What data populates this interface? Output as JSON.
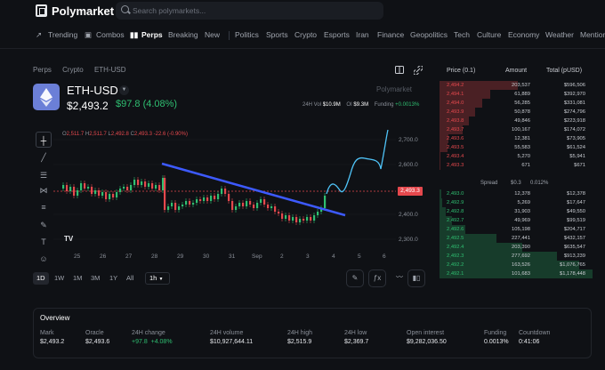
{
  "header": {
    "logo": "Polymarket",
    "search_placeholder": "Search polymarkets...",
    "categories": [
      "Trending",
      "Combos",
      "Perps",
      "Breaking",
      "New",
      "Politics",
      "Sports",
      "Crypto",
      "Esports",
      "Iran",
      "Finance",
      "Geopolitics",
      "Tech",
      "Culture",
      "Economy",
      "Weather",
      "Mention"
    ]
  },
  "market": {
    "breadcrumbs": [
      "Perps",
      "Crypto",
      "ETH-USD"
    ],
    "pair": "ETH-USD",
    "price": "$2,493.2",
    "change": "$97.8 (4.08%)",
    "watermark": "Polymarket",
    "stats": {
      "vol_label": "24H Vol",
      "vol": "$10.9M",
      "oi_label": "OI",
      "oi": "$9.3M",
      "funding_label": "Funding",
      "funding": "+0.0013%"
    }
  },
  "chart": {
    "ohlc": [
      "O",
      "2,511.7",
      "H",
      "2,511.7",
      "L",
      "2,492.8",
      "C",
      "2,493.3",
      "-22.6 (-0.90%)"
    ],
    "current_tag": "2,493.3",
    "price_ticks": [
      "2,700.0",
      "2,600.0",
      "2,500.0",
      "2,400.0",
      "2,300.0"
    ],
    "date_ticks": [
      "25",
      "26",
      "27",
      "28",
      "29",
      "30",
      "31",
      "Sep",
      "2",
      "3",
      "4",
      "5",
      "6"
    ],
    "timeframes": [
      "1D",
      "1W",
      "1M",
      "3M",
      "1Y",
      "All"
    ],
    "interval": "1h"
  },
  "orderbook": {
    "headers": [
      "Price (0.1)",
      "Amount",
      "Total (pUSD)"
    ],
    "asks": [
      [
        "2,494.2",
        "203,537",
        "$596,506"
      ],
      [
        "2,494.1",
        "61,889",
        "$392,970"
      ],
      [
        "2,494.0",
        "56,285",
        "$331,081"
      ],
      [
        "2,493.9",
        "50,878",
        "$274,796"
      ],
      [
        "2,493.8",
        "49,846",
        "$223,918"
      ],
      [
        "2,493.7",
        "100,167",
        "$174,072"
      ],
      [
        "2,493.6",
        "12,381",
        "$73,905"
      ],
      [
        "2,493.5",
        "55,583",
        "$61,524"
      ],
      [
        "2,493.4",
        "5,270",
        "$5,941"
      ],
      [
        "2,493.3",
        "671",
        "$671"
      ]
    ],
    "spread": [
      "Spread",
      "$0.3",
      "0.012%"
    ],
    "bids": [
      [
        "2,493.0",
        "12,378",
        "$12,378"
      ],
      [
        "2,492.9",
        "5,269",
        "$17,647"
      ],
      [
        "2,492.8",
        "31,903",
        "$49,550"
      ],
      [
        "2,492.7",
        "49,969",
        "$99,519"
      ],
      [
        "2,492.6",
        "105,198",
        "$204,717"
      ],
      [
        "2,492.5",
        "227,441",
        "$432,157"
      ],
      [
        "2,492.4",
        "203,390",
        "$635,547"
      ],
      [
        "2,492.3",
        "277,692",
        "$913,239"
      ],
      [
        "2,492.2",
        "163,526",
        "$1,076,765"
      ],
      [
        "2,492.1",
        "101,683",
        "$1,178,448"
      ]
    ],
    "ask_depth": [
      0.51,
      0.33,
      0.28,
      0.23,
      0.19,
      0.15,
      0.06,
      0.05,
      0.005,
      0.0006
    ],
    "bid_depth": [
      0.01,
      0.015,
      0.04,
      0.08,
      0.17,
      0.37,
      0.54,
      0.77,
      0.91,
      1.0
    ]
  },
  "overview": {
    "title": "Overview",
    "items": [
      {
        "label": "Mark",
        "value": "$2,493.2"
      },
      {
        "label": "Oracle",
        "value": "$2,493.6"
      },
      {
        "label": "24H change",
        "value": "+97.8",
        "value2": "+4.08%"
      },
      {
        "label": "24H volume",
        "value": "$10,927,644.11"
      },
      {
        "label": "24H high",
        "value": "$2,515.9"
      },
      {
        "label": "24H low",
        "value": "$2,369.7"
      },
      {
        "label": "Open interest",
        "value": "$9,282,036.50"
      },
      {
        "label": "Funding",
        "value": "0.0013%"
      },
      {
        "label": "Countdown",
        "value": "0:41:06"
      }
    ]
  },
  "colors": {
    "up": "#2fbf71",
    "down": "#e5484d",
    "trendline": "#3d5afe",
    "prediction": "#4fc3f7"
  }
}
